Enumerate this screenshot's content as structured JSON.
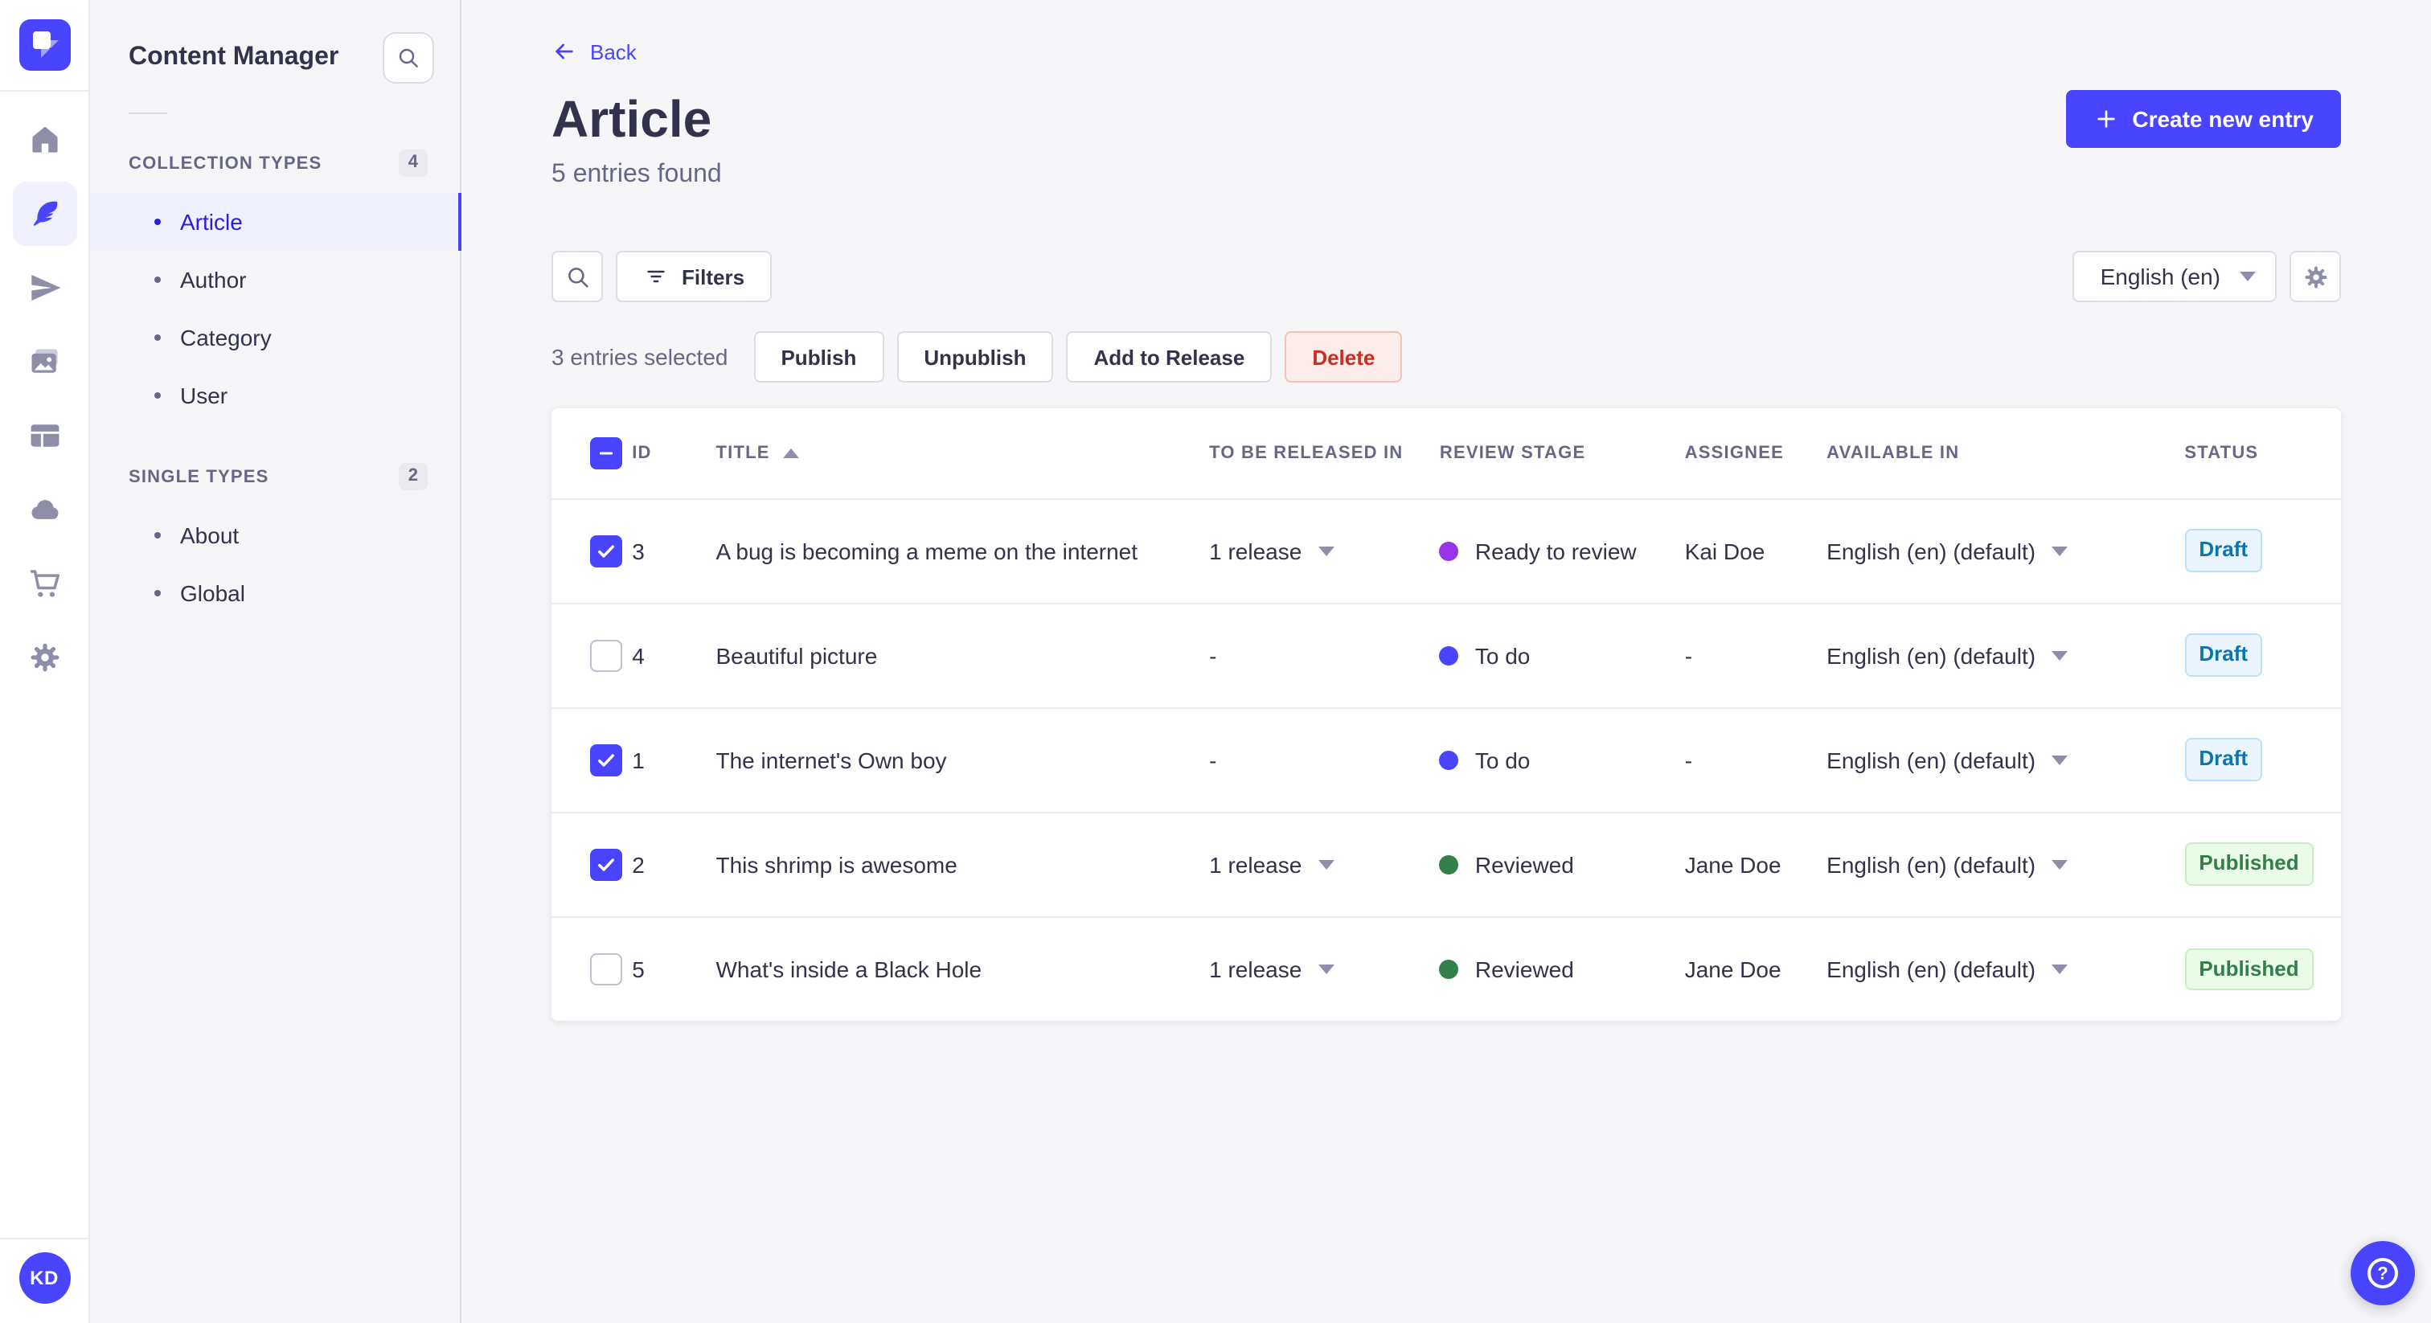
{
  "colors": {
    "accent": "#4945ff",
    "active_text": "#271fe0",
    "text": "#32324d",
    "muted": "#666687",
    "icon": "#8e8ea9",
    "border": "#dcdce4",
    "divider": "#eaeaef",
    "bg": "#f6f6f9",
    "danger_text": "#d02b20",
    "danger_bg": "#fcecea",
    "draft_text": "#0c75af",
    "draft_bg": "#eaf5ff",
    "published_text": "#328048",
    "published_bg": "#eafbe7"
  },
  "rail": {
    "items": [
      {
        "icon": "home-icon"
      },
      {
        "icon": "content-manager-feather-icon",
        "active": true
      },
      {
        "icon": "releases-paper-plane-icon"
      },
      {
        "icon": "media-library-images-icon"
      },
      {
        "icon": "content-type-builder-layout-icon"
      },
      {
        "icon": "deploy-cloud-icon"
      },
      {
        "icon": "marketplace-cart-icon"
      },
      {
        "icon": "settings-gear-icon"
      }
    ]
  },
  "user": {
    "initials": "KD"
  },
  "subnav": {
    "title": "Content Manager",
    "sections": [
      {
        "label": "COLLECTION TYPES",
        "count": "4",
        "items": [
          {
            "label": "Article",
            "active": true
          },
          {
            "label": "Author"
          },
          {
            "label": "Category"
          },
          {
            "label": "User"
          }
        ]
      },
      {
        "label": "SINGLE TYPES",
        "count": "2",
        "items": [
          {
            "label": "About"
          },
          {
            "label": "Global"
          }
        ]
      }
    ]
  },
  "header": {
    "back_label": "Back",
    "title": "Article",
    "subtitle": "5 entries found",
    "create_button": "Create new entry"
  },
  "toolbar": {
    "filters_label": "Filters",
    "locale_value": "English (en)"
  },
  "selection": {
    "text": "3 entries selected",
    "publish": "Publish",
    "unpublish": "Unpublish",
    "add_to_release": "Add to Release",
    "delete": "Delete"
  },
  "table": {
    "sorted_by": "TITLE",
    "sort_order": "asc",
    "columns": [
      "ID",
      "TITLE",
      "TO BE RELEASED IN",
      "REVIEW STAGE",
      "ASSIGNEE",
      "AVAILABLE IN",
      "STATUS"
    ],
    "rows": [
      {
        "checkbox": "checked",
        "id": "3",
        "title": "A bug is becoming a meme on the internet",
        "release": "1 release",
        "has_release": "true",
        "stage": "Ready to review",
        "stage_color": "#9736e8",
        "assignee": "Kai Doe",
        "locale": "English (en) (default)",
        "status": "Draft",
        "status_variant": "draft"
      },
      {
        "checkbox": "unchecked",
        "id": "4",
        "title": "Beautiful picture",
        "release": "-",
        "has_release": "false",
        "stage": "To do",
        "stage_color": "#4945ff",
        "assignee": "-",
        "locale": "English (en) (default)",
        "status": "Draft",
        "status_variant": "draft"
      },
      {
        "checkbox": "checked",
        "id": "1",
        "title": "The internet's Own boy",
        "release": "-",
        "has_release": "false",
        "stage": "To do",
        "stage_color": "#4945ff",
        "assignee": "-",
        "locale": "English (en) (default)",
        "status": "Draft",
        "status_variant": "draft"
      },
      {
        "checkbox": "checked",
        "id": "2",
        "title": "This shrimp is awesome",
        "release": "1 release",
        "has_release": "true",
        "stage": "Reviewed",
        "stage_color": "#328048",
        "assignee": "Jane Doe",
        "locale": "English (en) (default)",
        "status": "Published",
        "status_variant": "published"
      },
      {
        "checkbox": "unchecked",
        "id": "5",
        "title": "What's inside a Black Hole",
        "release": "1 release",
        "has_release": "true",
        "stage": "Reviewed",
        "stage_color": "#328048",
        "assignee": "Jane Doe",
        "locale": "English (en) (default)",
        "status": "Published",
        "status_variant": "published"
      }
    ]
  }
}
